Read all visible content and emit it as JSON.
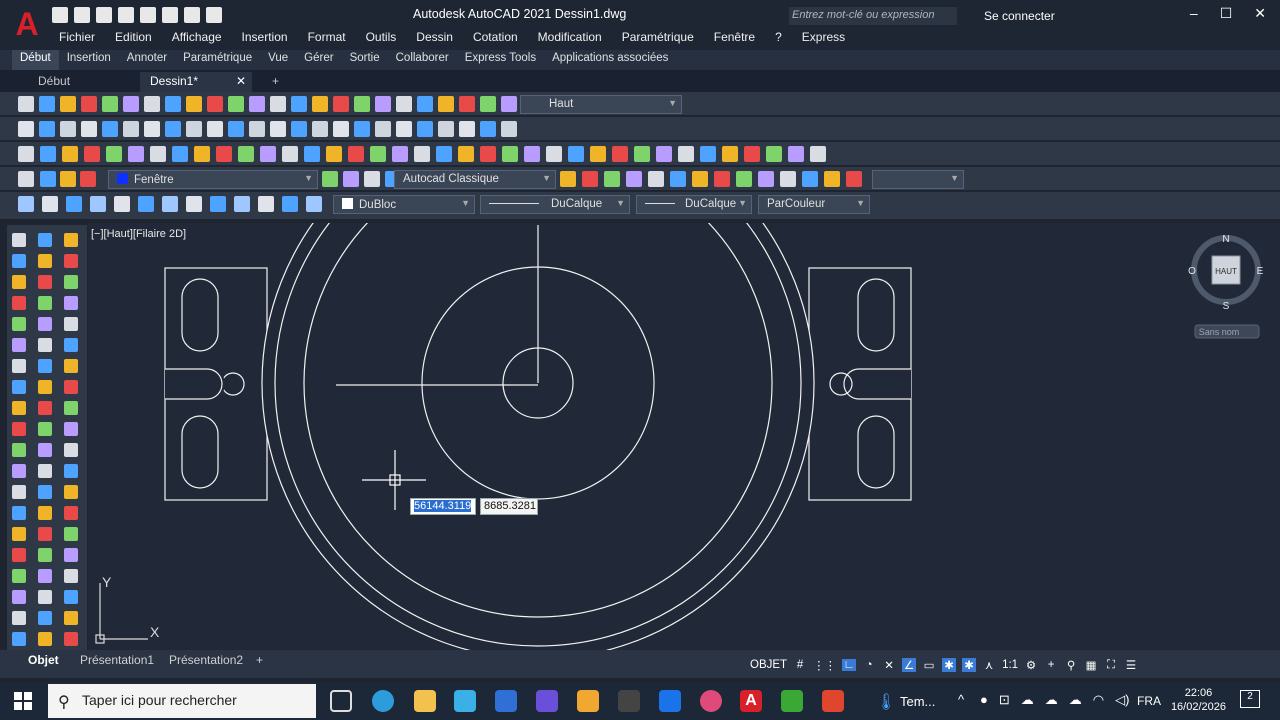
{
  "app": {
    "title": "Autodesk AutoCAD 2021     Dessin1.dwg",
    "search_placeholder": "Entrez mot-clé ou expression",
    "signin": "Se connecter"
  },
  "menu": [
    "Fichier",
    "Edition",
    "Affichage",
    "Insertion",
    "Format",
    "Outils",
    "Dessin",
    "Cotation",
    "Modification",
    "Paramétrique",
    "Fenêtre",
    "?",
    "Express"
  ],
  "ribbon_tabs": [
    "Début",
    "Insertion",
    "Annoter",
    "Paramétrique",
    "Vue",
    "Gérer",
    "Sortie",
    "Collaborer",
    "Express Tools",
    "Applications associées"
  ],
  "doc_tabs": [
    "Début",
    "Dessin1*"
  ],
  "toolbars": {
    "view_combo": "Haut",
    "layer_combo": "Fenêtre",
    "workspace_combo": "Autocad Classique",
    "color_combo": "DuBloc",
    "linetype_combo": "DuCalque",
    "lineweight_combo": "DuCalque",
    "plotstyle_combo": "ParCouleur"
  },
  "viewport": {
    "label": "[−][Haut][Filaire 2D]",
    "coord_x": "56144.3119",
    "coord_y": "8685.3281",
    "ucs_x": "X",
    "ucs_y": "Y"
  },
  "viewcube": {
    "n": "N",
    "s": "S",
    "e": "E",
    "w": "O",
    "face": "HAUT",
    "ucs_menu": "Sans nom"
  },
  "layout_tabs": [
    "Objet",
    "Présentation1",
    "Présentation2"
  ],
  "status": {
    "objet": "OBJET",
    "scale": "1:1"
  },
  "taskbar": {
    "search": "Taper ici pour rechercher",
    "temp": "Tem...",
    "lang": "FRA",
    "time": "22:06",
    "date": "16/02/2026",
    "notif": "2"
  },
  "colors": {
    "accent": "#d8202a",
    "canvas": "#212837",
    "toolbar": "#2e3847"
  }
}
